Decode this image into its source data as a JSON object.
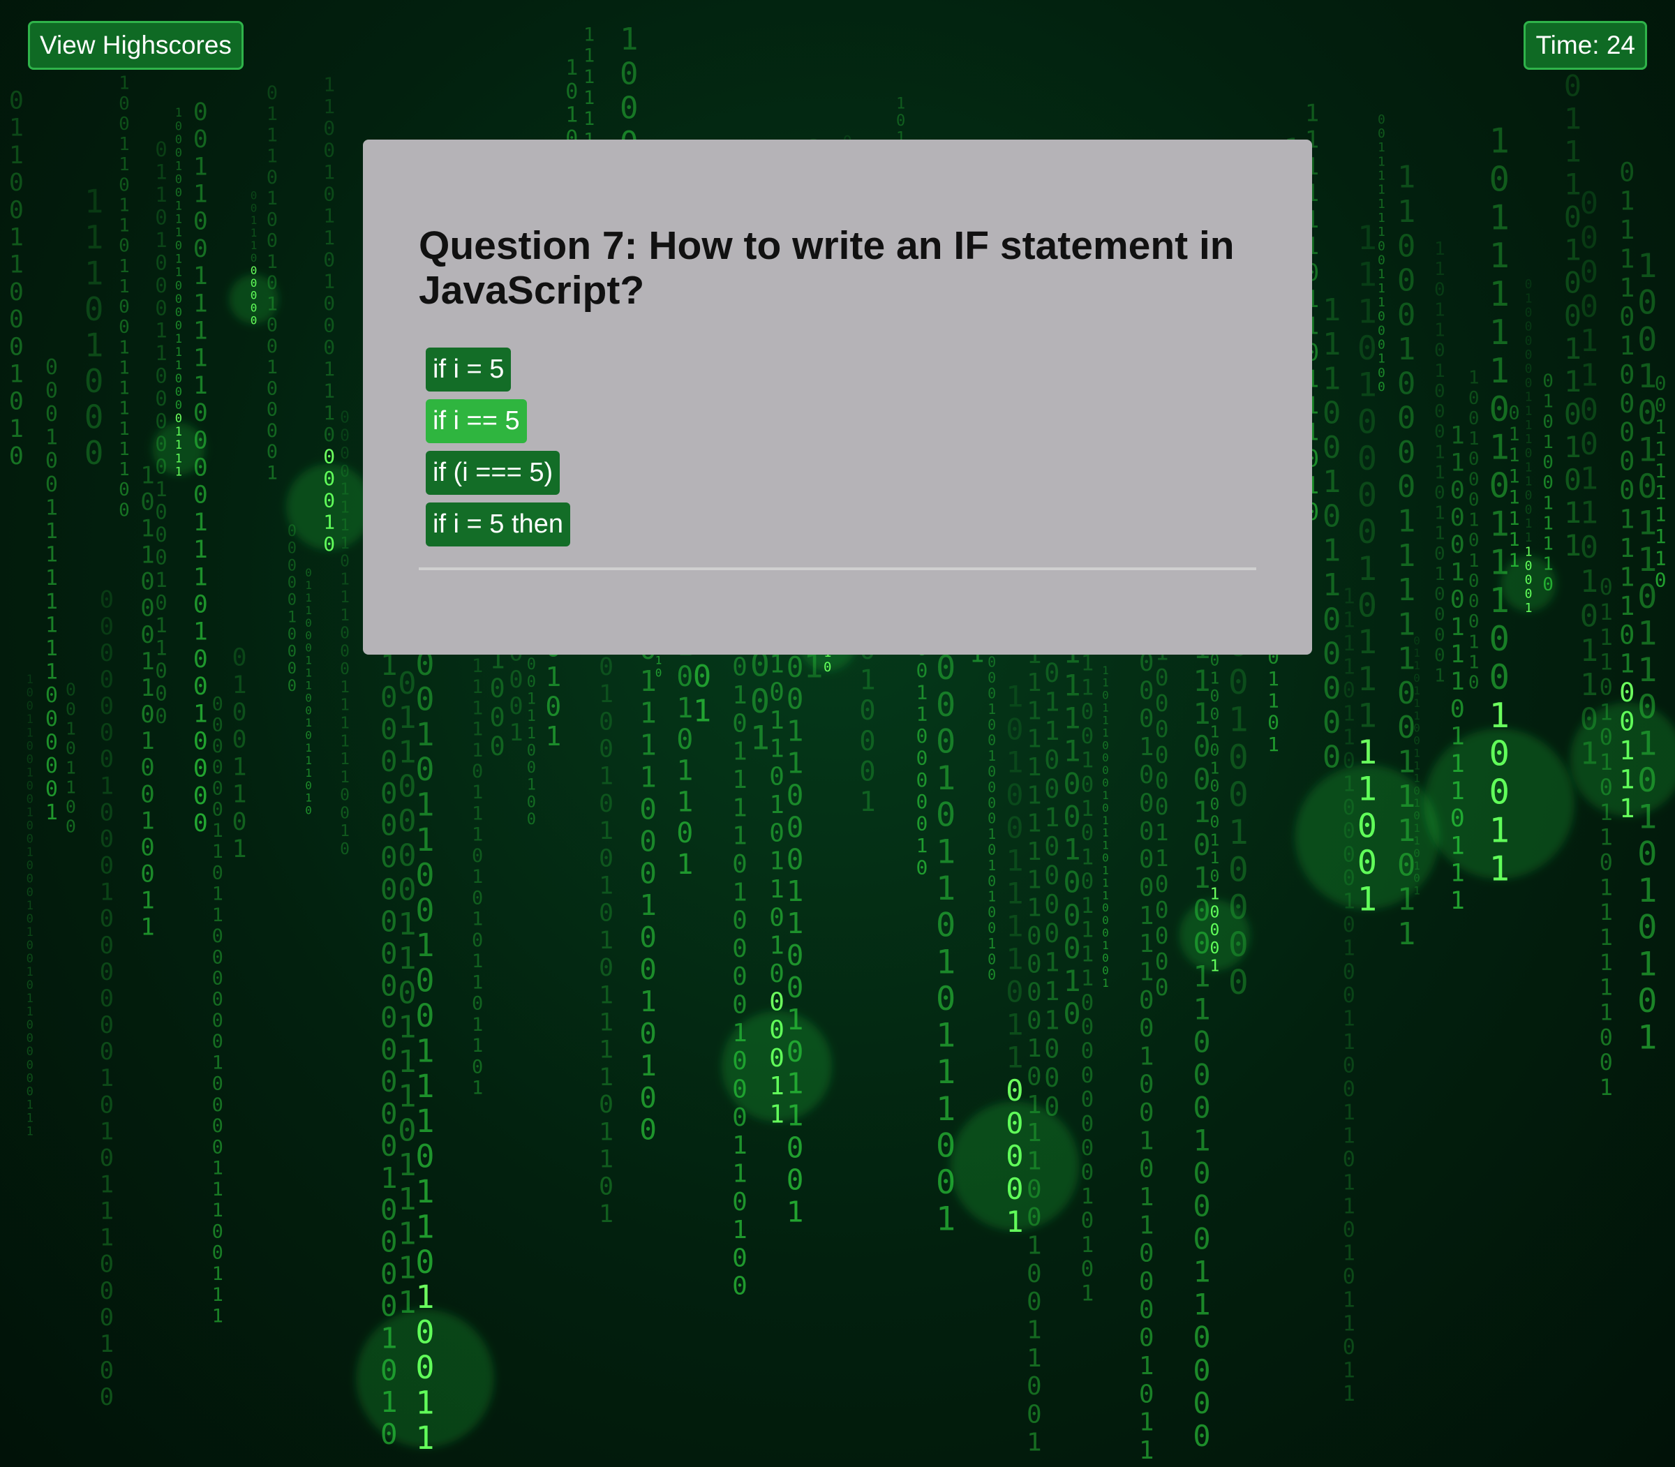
{
  "header": {
    "highscores_label": "View Highscores",
    "timer_label": "Time: 24"
  },
  "quiz": {
    "question": "Question 7: How to write an IF statement in JavaScript?",
    "answers": [
      {
        "label": "if i = 5"
      },
      {
        "label": "if i == 5"
      },
      {
        "label": "if (i === 5)"
      },
      {
        "label": "if i = 5 then"
      }
    ],
    "hovered_answer_index": 1
  },
  "background": {
    "theme": "matrix-digital-rain",
    "glyphs": [
      "0",
      "1"
    ]
  },
  "colors": {
    "button_green": "#136d27",
    "button_border": "#2fb34a",
    "hover_green": "#2fb53f",
    "card_gray": "#b5b3b7",
    "rain_green": "#39ff4a",
    "background_dark": "#021a0c"
  }
}
